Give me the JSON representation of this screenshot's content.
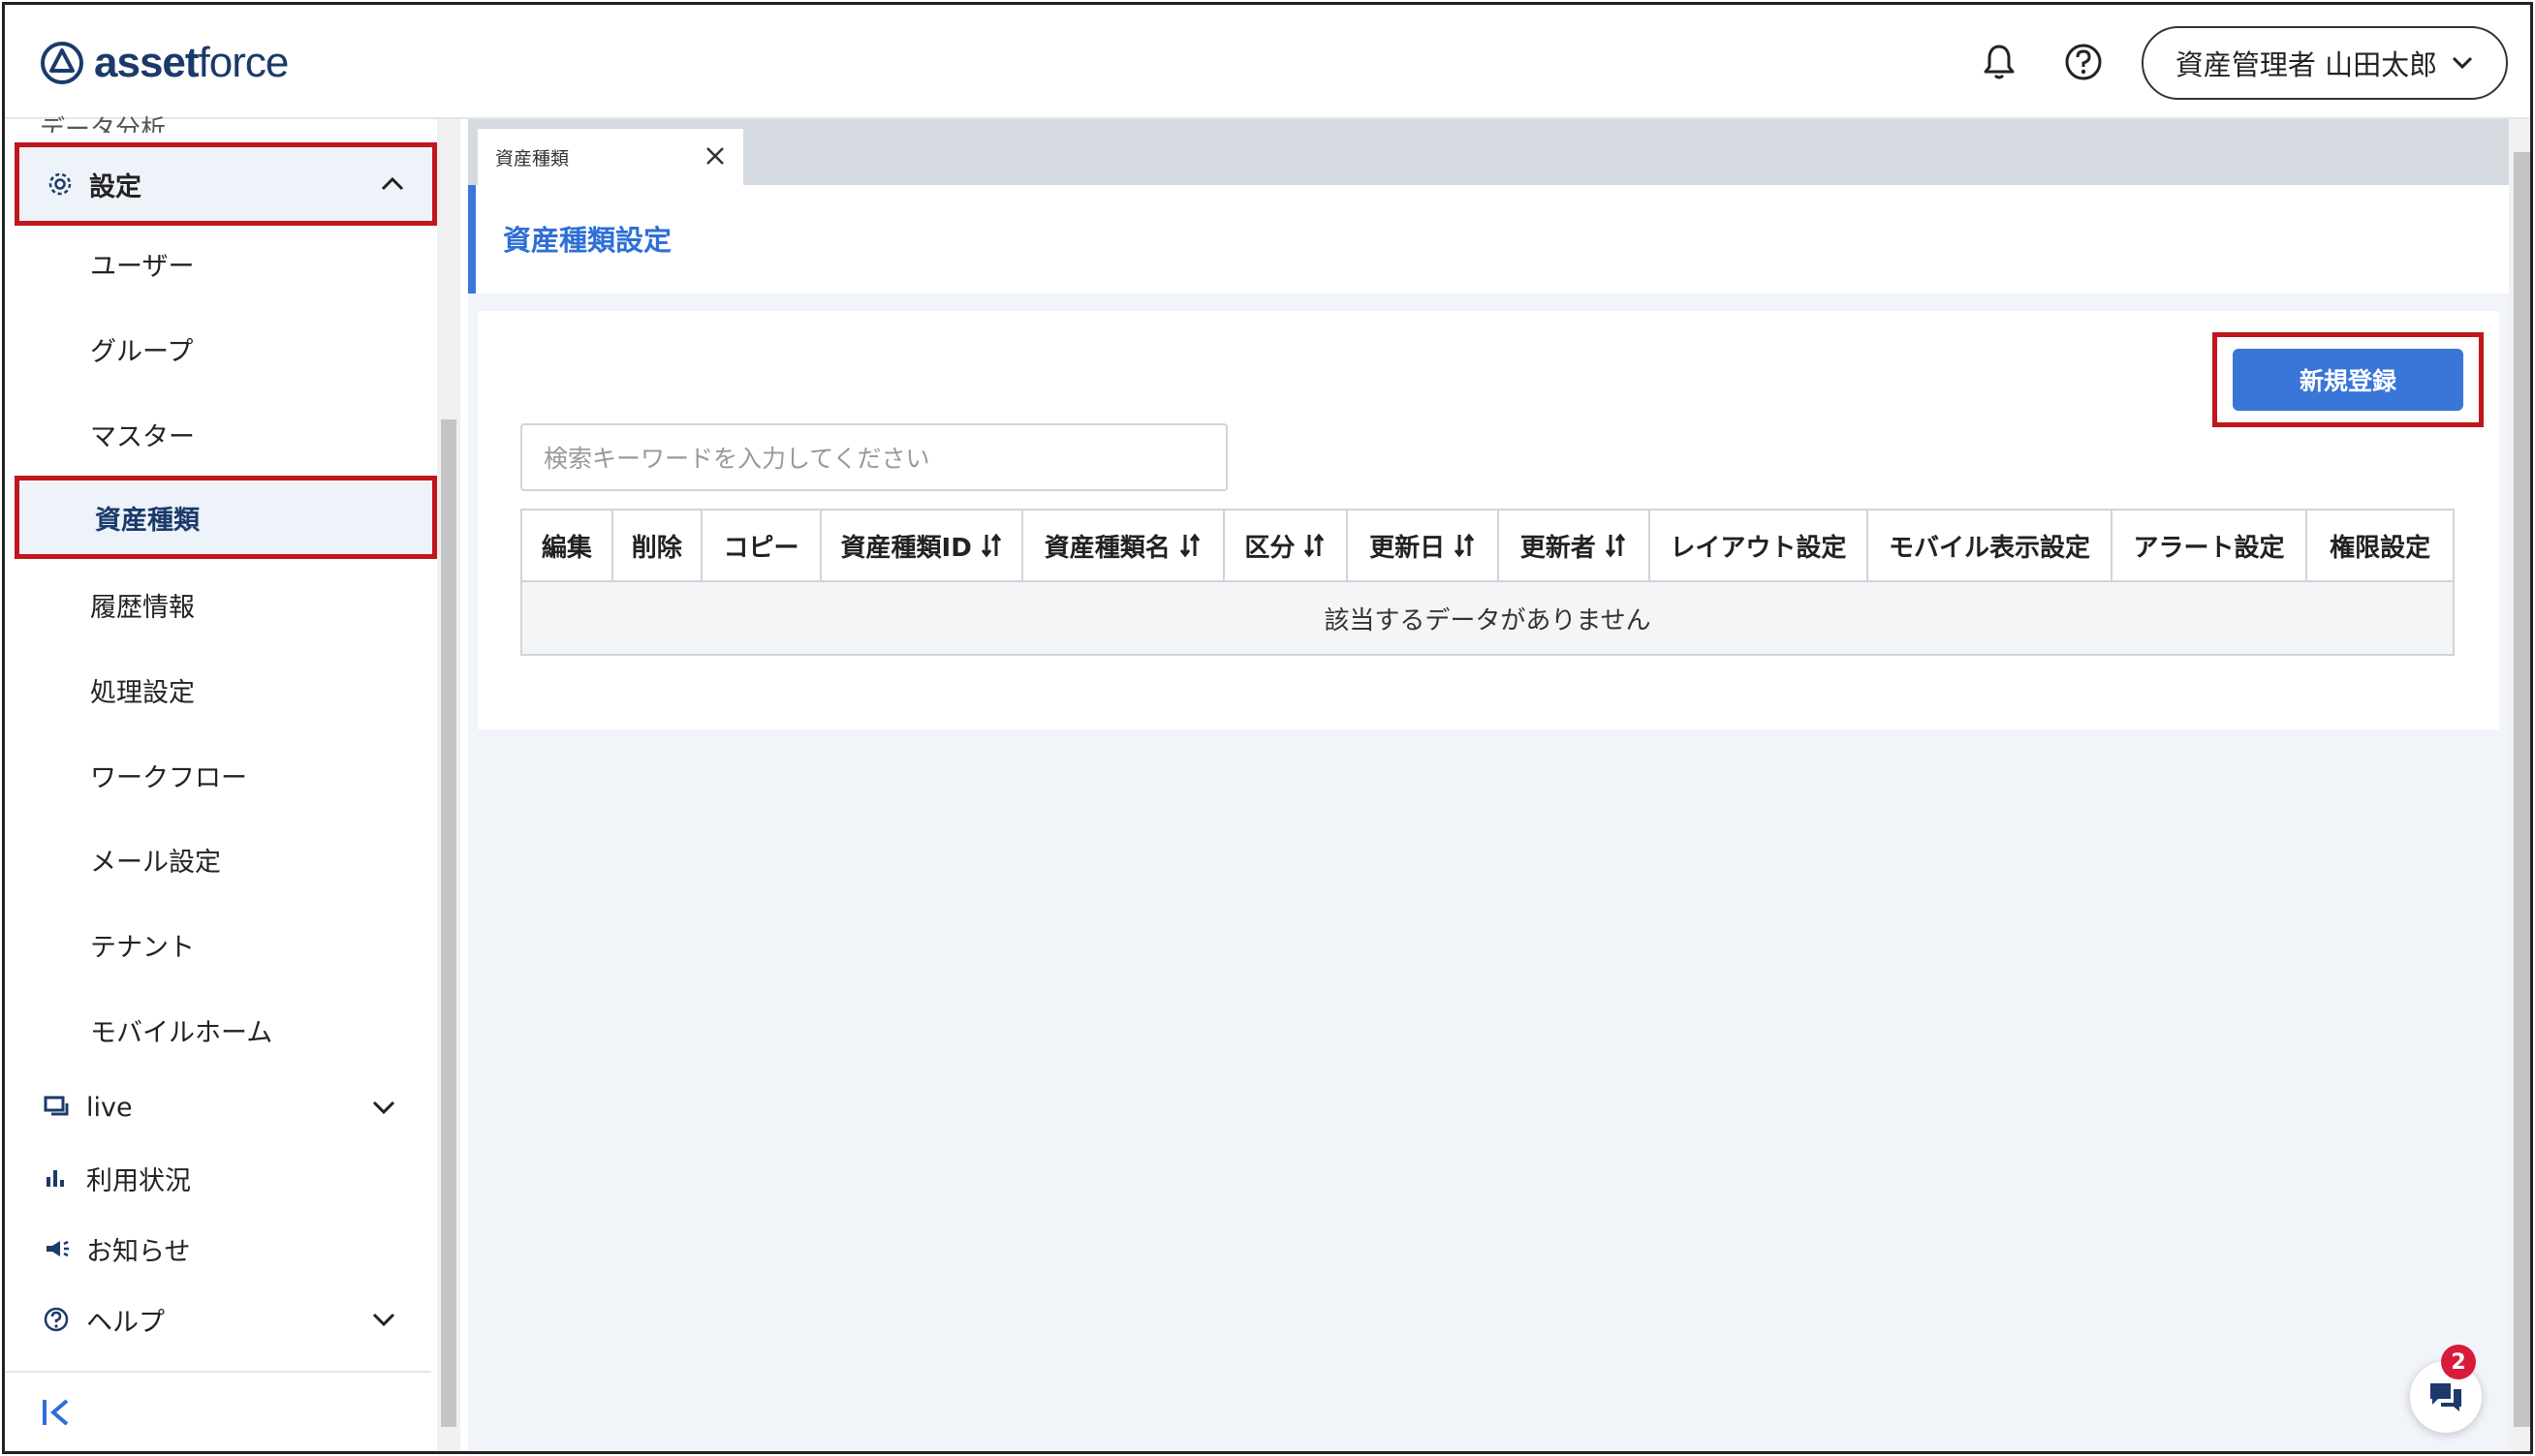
{
  "app": {
    "logo_bold": "asset",
    "logo_light": "force",
    "user_label": "資産管理者 山田太郎"
  },
  "sidebar": {
    "partial_item": "データ分析",
    "settings_label": "設定",
    "sub_items": [
      "ユーザー",
      "グループ",
      "マスター",
      "資産種類",
      "履歴情報",
      "処理設定",
      "ワークフロー",
      "メール設定",
      "テナント",
      "モバイルホーム"
    ],
    "active_item": "資産種類",
    "top_items": [
      {
        "label": "live",
        "icon": "live-icon",
        "expandable": true
      },
      {
        "label": "利用状況",
        "icon": "bar-chart-icon",
        "expandable": false
      },
      {
        "label": "お知らせ",
        "icon": "megaphone-icon",
        "expandable": false
      },
      {
        "label": "ヘルプ",
        "icon": "help-circle-icon",
        "expandable": true
      }
    ],
    "collapse_glyph": "|<"
  },
  "tabs": [
    {
      "label": "資産種類"
    }
  ],
  "page": {
    "title": "資産種類設定",
    "new_button": "新規登録",
    "search_placeholder": "検索キーワードを入力してください"
  },
  "table": {
    "columns": [
      {
        "label": "編集",
        "sortable": false
      },
      {
        "label": "削除",
        "sortable": false
      },
      {
        "label": "コピー",
        "sortable": false
      },
      {
        "label": "資産種類ID",
        "sortable": true
      },
      {
        "label": "資産種類名",
        "sortable": true
      },
      {
        "label": "区分",
        "sortable": true
      },
      {
        "label": "更新日",
        "sortable": true
      },
      {
        "label": "更新者",
        "sortable": true
      },
      {
        "label": "レイアウト設定",
        "sortable": false
      },
      {
        "label": "モバイル表示設定",
        "sortable": false
      },
      {
        "label": "アラート設定",
        "sortable": false
      },
      {
        "label": "権限設定",
        "sortable": false
      }
    ],
    "empty_message": "該当するデータがありません"
  },
  "chat": {
    "badge_count": "2"
  },
  "colors": {
    "accent": "#3a76d8",
    "highlight": "#c0161c",
    "brand": "#1b3a6b"
  }
}
